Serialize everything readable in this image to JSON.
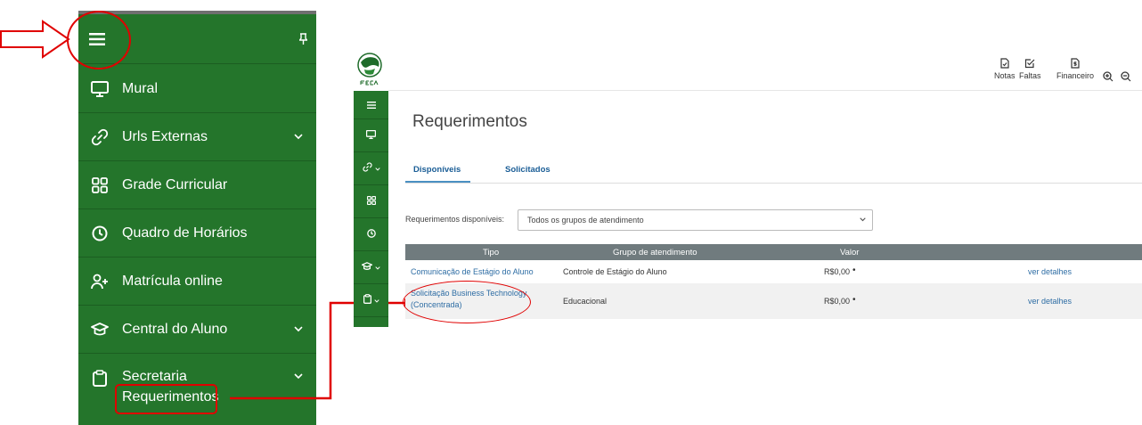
{
  "sidebar": {
    "items": [
      {
        "label": "Mural",
        "icon": "monitor-icon"
      },
      {
        "label": "Urls Externas",
        "icon": "link-icon",
        "expandable": true
      },
      {
        "label": "Grade Curricular",
        "icon": "grid-icon"
      },
      {
        "label": "Quadro de Horários",
        "icon": "clock-icon"
      },
      {
        "label": "Matrícula online",
        "icon": "user-plus-icon"
      },
      {
        "label": "Central do Aluno",
        "icon": "graduation-cap-icon",
        "expandable": true
      },
      {
        "label": "Secretaria",
        "icon": "clipboard-icon",
        "expandable": true
      }
    ],
    "subitem": "Requerimentos"
  },
  "toolbar": {
    "notas": "Notas",
    "faltas": "Faltas",
    "financeiro": "Financeiro"
  },
  "page": {
    "title": "Requerimentos",
    "tabs": [
      "Disponíveis",
      "Solicitados"
    ],
    "filter_label": "Requerimentos disponíveis:",
    "filter_value": "Todos os grupos de atendimento"
  },
  "table": {
    "headers": [
      "Tipo",
      "Grupo de atendimento",
      "Valor"
    ],
    "rows": [
      {
        "tipo": "Comunicação de Estágio do Aluno",
        "grupo": "Controle de Estágio do Aluno",
        "valor": "R$0,00",
        "marker": "•",
        "action": "ver detalhes"
      },
      {
        "tipo_line1": "Solicitação Business Technology",
        "tipo_line2": "(Concentrada)",
        "grupo": "Educacional",
        "valor": "R$0,00",
        "marker": "•",
        "action": "ver detalhes"
      }
    ]
  },
  "colors": {
    "sidebar_green": "#24752b",
    "annotation_red": "#e00000",
    "table_header": "#707b7e",
    "link_blue": "#2e6da4"
  }
}
